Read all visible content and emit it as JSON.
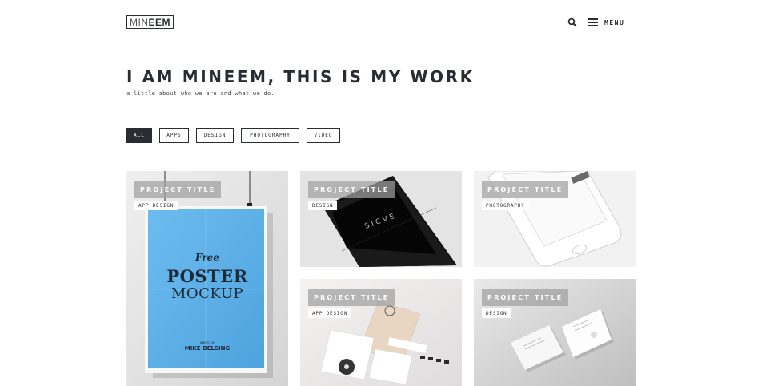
{
  "header": {
    "logo_light": "MIN",
    "logo_bold": "EEM",
    "menu_label": "MENU"
  },
  "hero": {
    "title": "I AM MINEEM, THIS IS MY WORK",
    "subtitle": "a little about who we are and what we do."
  },
  "filters": [
    "ALL",
    "APPS",
    "DESIGN",
    "PHOTOGRAPHY",
    "VIDEO"
  ],
  "active_filter": "ALL",
  "projects": [
    {
      "title": "PROJECT TITLE",
      "category": "APP DESIGN",
      "image": "poster-mockup",
      "poster": {
        "line1": "Free",
        "line2": "POSTER",
        "line3": "MOCKUP",
        "credit1": "MADE BY",
        "credit2": "MIKE DELSING"
      }
    },
    {
      "title": "PROJECT TITLE",
      "category": "DESIGN",
      "image": "dark-phone-mockup",
      "phone_text": "SICVE"
    },
    {
      "title": "PROJECT TITLE",
      "category": "PHOTOGRAPHY",
      "image": "white-phone-mockup"
    },
    {
      "title": "PROJECT TITLE",
      "category": "APP DESIGN",
      "image": "stationery-mockup"
    },
    {
      "title": "PROJECT TITLE",
      "category": "DESIGN",
      "image": "business-card-mockup"
    }
  ],
  "colors": {
    "dark": "#2a2c33",
    "poster_blue": "#5fb0e6",
    "tag_overlay": "#a0a0a0"
  }
}
